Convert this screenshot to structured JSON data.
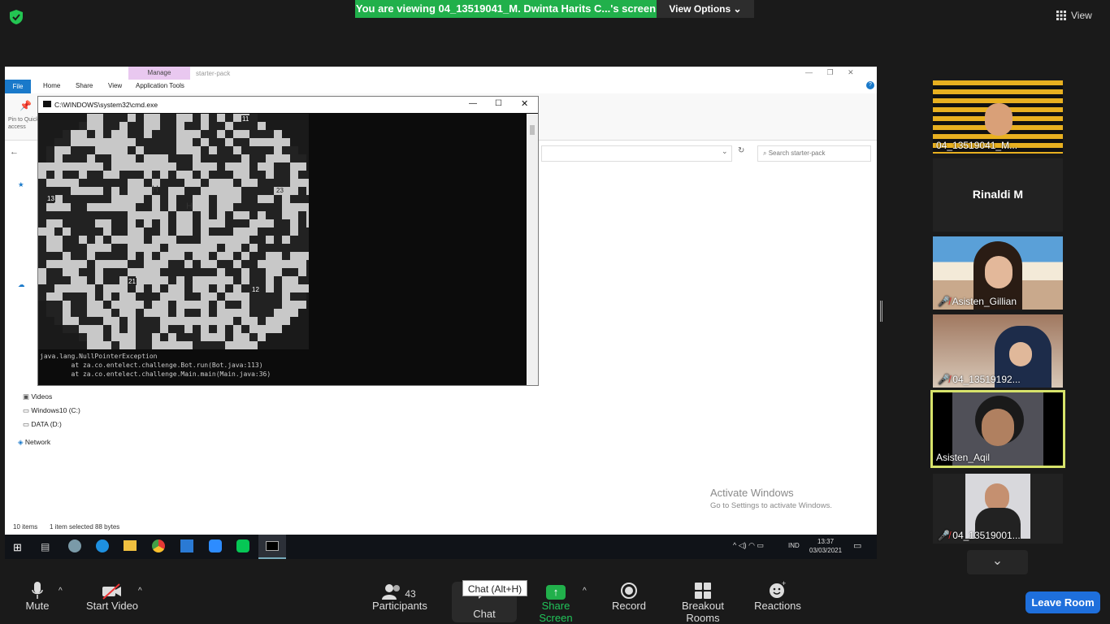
{
  "banner": {
    "text": "You are viewing 04_13519041_M. Dwinta Harits C...'s screen"
  },
  "view_options": {
    "label": "View Options"
  },
  "view_button": {
    "label": "View"
  },
  "explorer": {
    "manage_tab": "Manage",
    "window_title": "starter-pack",
    "tabs": [
      "File",
      "Home",
      "Share",
      "View",
      "Application Tools"
    ],
    "pin_label": "Pin to Quick access",
    "search_placeholder": "Search starter-pack",
    "nav_items": [
      "Videos",
      "Windows10 (C:)",
      "DATA (D:)",
      "Network"
    ],
    "status_items": "10 items",
    "status_selected": "1 item selected  88 bytes",
    "activate_title": "Activate Windows",
    "activate_sub": "Go to Settings to activate Windows."
  },
  "cmd": {
    "title": "C:\\WINDOWS\\system32\\cmd.exe",
    "map_labels": [
      "11",
      "13",
      "23",
      "21",
      "12"
    ],
    "map_letters": [
      "H",
      "H"
    ],
    "lines": [
      "java.lang.NullPointerException",
      "        at za.co.entelect.challenge.Bot.run(Bot.java:113)",
      "        at za.co.entelect.challenge.Main.main(Main.java:36)"
    ]
  },
  "taskbar": {
    "lang": "IND",
    "time": "13:37",
    "date": "03/03/2021"
  },
  "participants_tiles": [
    {
      "name": "04_13519041_M...",
      "muted": false,
      "color": "#e8b020"
    },
    {
      "name": "Rinaldi M",
      "muted": false,
      "color": "#222222"
    },
    {
      "name": "Asisten_Gillian",
      "muted": true,
      "color": "#6aa8c8"
    },
    {
      "name": "04_13519192...",
      "muted": true,
      "color": "#b89a80"
    },
    {
      "name": "Asisten_Aqil",
      "muted": false,
      "color": "#505058"
    },
    {
      "name": "04_13519001...",
      "muted": true,
      "color": "#d8d8dc"
    }
  ],
  "toolbar": {
    "mute": "Mute",
    "start_video": "Start Video",
    "participants": "Participants",
    "participants_count": "43",
    "chat": "Chat",
    "chat_tooltip": "Chat (Alt+H)",
    "share_screen": "Share Screen",
    "record": "Record",
    "breakout": "Breakout Rooms",
    "reactions": "Reactions",
    "leave": "Leave Room"
  },
  "colors": {
    "accent_green": "#21b04b",
    "leave_blue": "#1e6fdc",
    "speaker_highlight": "#d7e36b"
  }
}
